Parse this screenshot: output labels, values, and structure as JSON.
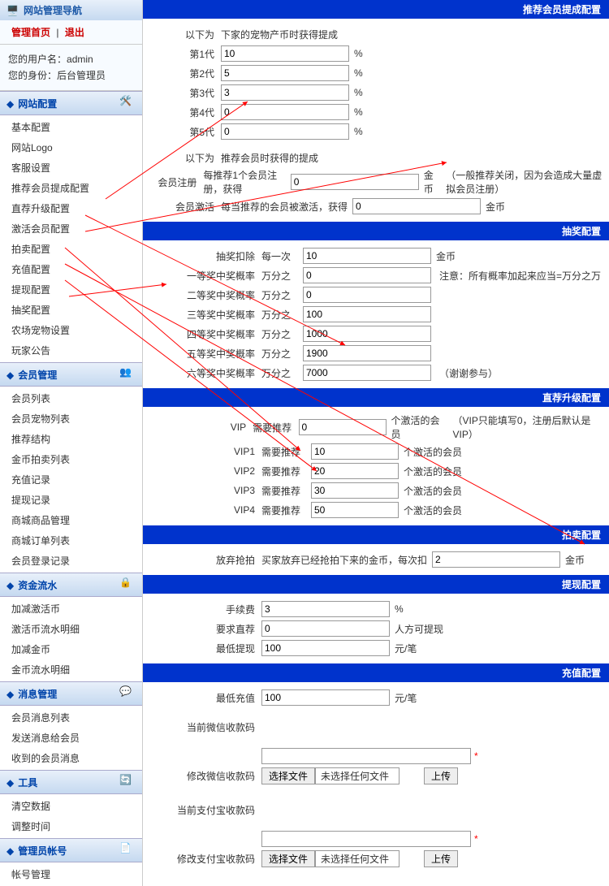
{
  "sidebar": {
    "nav_title": "网站管理导航",
    "auth": {
      "home": "管理首页",
      "sep": "|",
      "logout": "退出"
    },
    "user_label": "您的用户名：",
    "user_name": "admin",
    "role_label": "您的身份：",
    "role_name": "后台管理员",
    "sections": [
      {
        "title": "网站配置",
        "icon": "tools",
        "items": [
          "基本配置",
          "网站Logo",
          "客服设置",
          "推荐会员提成配置",
          "直荐升级配置",
          "激活会员配置",
          "拍卖配置",
          "充值配置",
          "提现配置",
          "抽奖配置",
          "农场宠物设置",
          "玩家公告"
        ]
      },
      {
        "title": "会员管理",
        "icon": "users",
        "items": [
          "会员列表",
          "会员宠物列表",
          "推荐结构",
          "金币拍卖列表",
          "充值记录",
          "提现记录",
          "商城商品管理",
          "商城订单列表",
          "会员登录记录"
        ]
      },
      {
        "title": "资金流水",
        "icon": "lock",
        "items": [
          "加减激活币",
          "激活币流水明细",
          "加减金币",
          "金币流水明细"
        ]
      },
      {
        "title": "消息管理",
        "icon": "chat",
        "items": [
          "会员消息列表",
          "发送消息给会员",
          "收到的会员消息"
        ]
      },
      {
        "title": "工具",
        "icon": "refresh",
        "items": [
          "清空数据",
          "调整时间"
        ]
      },
      {
        "title": "管理员帐号",
        "icon": "doc",
        "items": [
          "帐号管理"
        ]
      }
    ]
  },
  "referral": {
    "title": "推荐会员提成配置",
    "below_label": "以下为",
    "gen_desc": "下家的宠物产币时获得提成",
    "gens": [
      {
        "label": "第1代",
        "val": "10",
        "unit": "%"
      },
      {
        "label": "第2代",
        "val": "5",
        "unit": "%"
      },
      {
        "label": "第3代",
        "val": "3",
        "unit": "%"
      },
      {
        "label": "第4代",
        "val": "0",
        "unit": "%"
      },
      {
        "label": "第5代",
        "val": "0",
        "unit": "%"
      }
    ],
    "reg_desc": "推荐会员时获得的提成",
    "reg_row": {
      "label": "会员注册",
      "pre": "每推荐1个会员注册，获得",
      "val": "0",
      "unit": "金币",
      "note": "（一般推荐关闭，因为会造成大量虚拟会员注册）"
    },
    "act_row": {
      "label": "会员激活",
      "pre": "每当推荐的会员被激活，获得",
      "val": "0",
      "unit": "金币"
    }
  },
  "lottery": {
    "title": "抽奖配置",
    "deduct": {
      "label": "抽奖扣除",
      "pre": "每一次",
      "val": "10",
      "unit": "金币"
    },
    "prizes": [
      {
        "label": "一等奖中奖概率",
        "pre": "万分之",
        "val": "0",
        "note": "注意：所有概率加起来应当=万分之万"
      },
      {
        "label": "二等奖中奖概率",
        "pre": "万分之",
        "val": "0",
        "note": ""
      },
      {
        "label": "三等奖中奖概率",
        "pre": "万分之",
        "val": "100",
        "note": ""
      },
      {
        "label": "四等奖中奖概率",
        "pre": "万分之",
        "val": "1000",
        "note": ""
      },
      {
        "label": "五等奖中奖概率",
        "pre": "万分之",
        "val": "1900",
        "note": ""
      },
      {
        "label": "六等奖中奖概率",
        "pre": "万分之",
        "val": "7000",
        "note": "（谢谢参与）"
      }
    ]
  },
  "upgrade": {
    "title": "直荐升级配置",
    "rows": [
      {
        "label": "VIP",
        "pre": "需要推荐",
        "val": "0",
        "suf": "个激活的会员",
        "note": "（VIP只能填写0，注册后默认是VIP）"
      },
      {
        "label": "VIP1",
        "pre": "需要推荐",
        "val": "10",
        "suf": "个激活的会员",
        "note": ""
      },
      {
        "label": "VIP2",
        "pre": "需要推荐",
        "val": "20",
        "suf": "个激活的会员",
        "note": ""
      },
      {
        "label": "VIP3",
        "pre": "需要推荐",
        "val": "30",
        "suf": "个激活的会员",
        "note": ""
      },
      {
        "label": "VIP4",
        "pre": "需要推荐",
        "val": "50",
        "suf": "个激活的会员",
        "note": ""
      }
    ]
  },
  "auction": {
    "title": "拍卖配置",
    "row": {
      "label": "放弃抢拍",
      "pre": "买家放弃已经抢拍下来的金币，每次扣",
      "val": "2",
      "unit": "金币"
    }
  },
  "withdraw": {
    "title": "提现配置",
    "rows": [
      {
        "label": "手续费",
        "val": "3",
        "unit": "%"
      },
      {
        "label": "要求直荐",
        "val": "0",
        "unit": "人方可提现"
      },
      {
        "label": "最低提现",
        "val": "100",
        "unit": "元/笔"
      }
    ]
  },
  "recharge": {
    "title": "充值配置",
    "min": {
      "label": "最低充值",
      "val": "100",
      "unit": "元/笔"
    },
    "wechat_cur": "当前微信收款码",
    "wechat_mod": "修改微信收款码",
    "alipay_cur": "当前支付宝收款码",
    "alipay_mod": "修改支付宝收款码",
    "choose_file": "选择文件",
    "no_file": "未选择任何文件",
    "upload": "上传"
  }
}
